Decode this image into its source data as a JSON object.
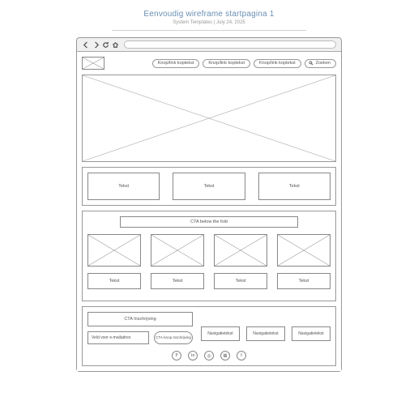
{
  "doc": {
    "title": "Eenvoudig wireframe startpagina 1",
    "meta": "System Templates  |  July 24, 2025"
  },
  "header": {
    "nav_links": [
      "Knop/link koptekst",
      "Knop/link koptekst",
      "Knop/link koptekst"
    ],
    "search_label": "Zoeken"
  },
  "cards3": [
    "Tekst",
    "Tekst",
    "Tekst"
  ],
  "cta_bar": "CTA below the fold",
  "labels4": [
    "Tekst",
    "Tekst",
    "Tekst",
    "Tekst"
  ],
  "footer": {
    "cta_box": "CTA Inschrijving",
    "email_ph": "Veld voor e-mailadres",
    "cta_btn": "CTA-knop Inschrijving",
    "nav": [
      "Navigatietekst",
      "Navigatietekst",
      "Navigatietekst"
    ],
    "social": [
      "P",
      "in",
      "◎",
      "𝌆",
      "f"
    ]
  }
}
